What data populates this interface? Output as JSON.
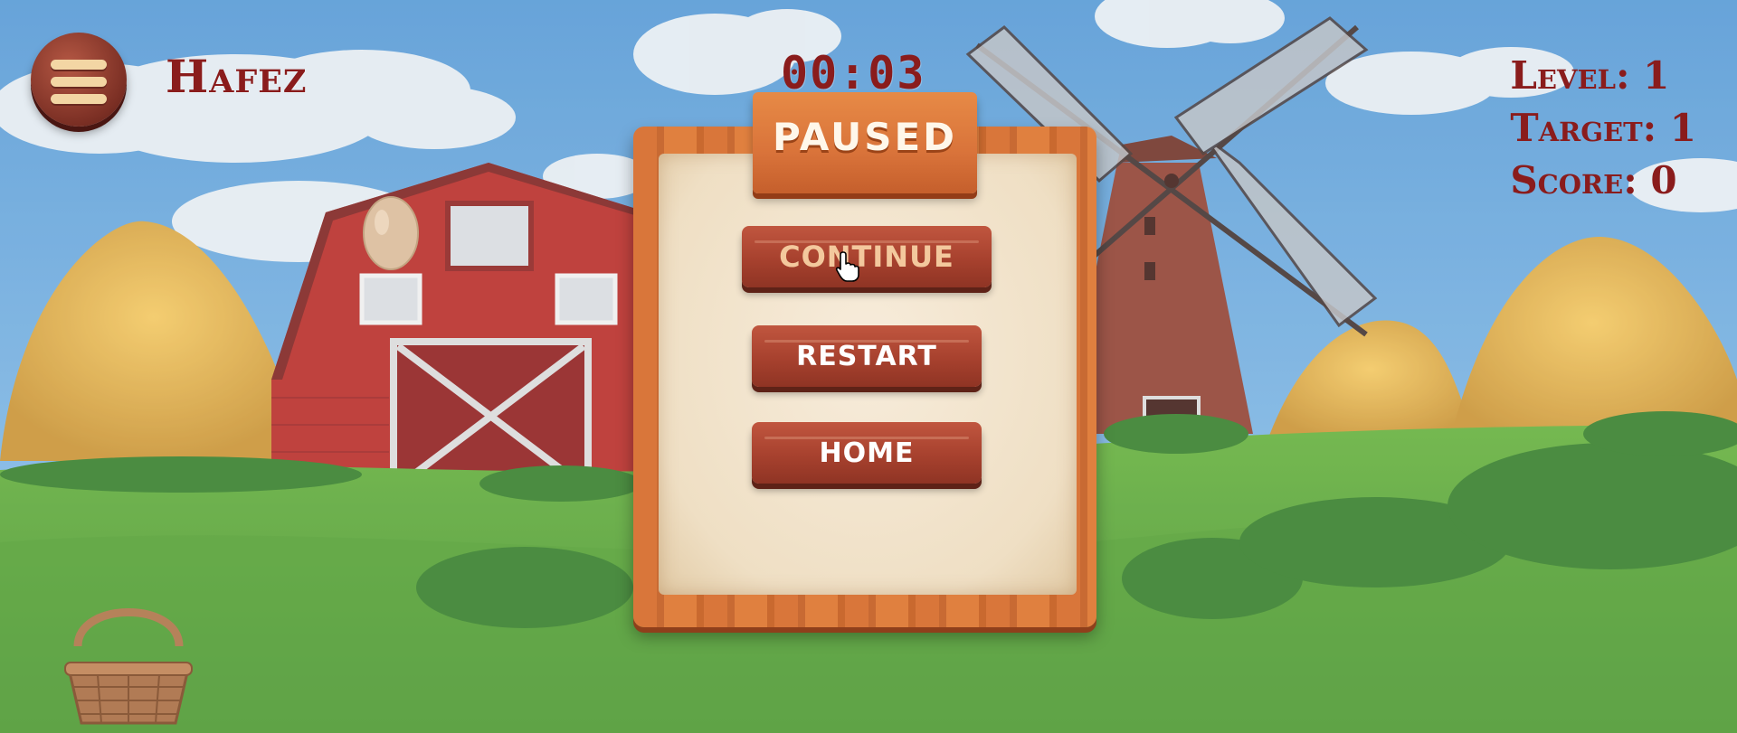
{
  "hud": {
    "player_name": "Hafez",
    "timer": "00:03",
    "level_label": "Level: 1",
    "target_label": "Target: 1",
    "score_label": "Score: 0",
    "menu_icon": "hamburger-menu-icon"
  },
  "pause_menu": {
    "title": "PAUSED",
    "buttons": [
      {
        "label": "CONTINUE",
        "state": "hovered"
      },
      {
        "label": "RESTART"
      },
      {
        "label": "HOME"
      }
    ]
  },
  "colors": {
    "hud_text": "#8a1c1c",
    "wood_button": "#a7412e",
    "panel_wood": "#d9763a",
    "paper": "#f3e6d0",
    "sky": "#5b9fd6",
    "grass": "#4e9a2e"
  },
  "icons": [
    "hamburger-menu-icon",
    "pointer-hand-icon",
    "basket-icon",
    "egg-icon"
  ]
}
